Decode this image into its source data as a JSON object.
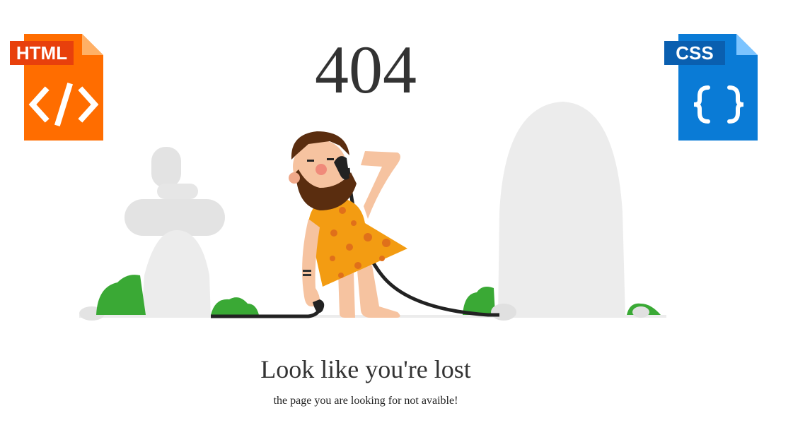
{
  "badges": {
    "html": {
      "label": "HTML",
      "icon": "code-brackets-icon",
      "color": "#ff6d00"
    },
    "css": {
      "label": "CSS",
      "icon": "curly-braces-icon",
      "color": "#0a7bd6"
    }
  },
  "error": {
    "code": "404",
    "heading": "Look like you're lost",
    "message": "the page you are looking for not avaible!"
  },
  "illustration": {
    "name": "caveman-on-phone-illustration",
    "colors": {
      "rock": "#e8e8e8",
      "bush": "#3aa935",
      "skin": "#f6c3a0",
      "beard": "#5a2d0f",
      "tunic": "#f39c12",
      "cable": "#222222"
    }
  }
}
